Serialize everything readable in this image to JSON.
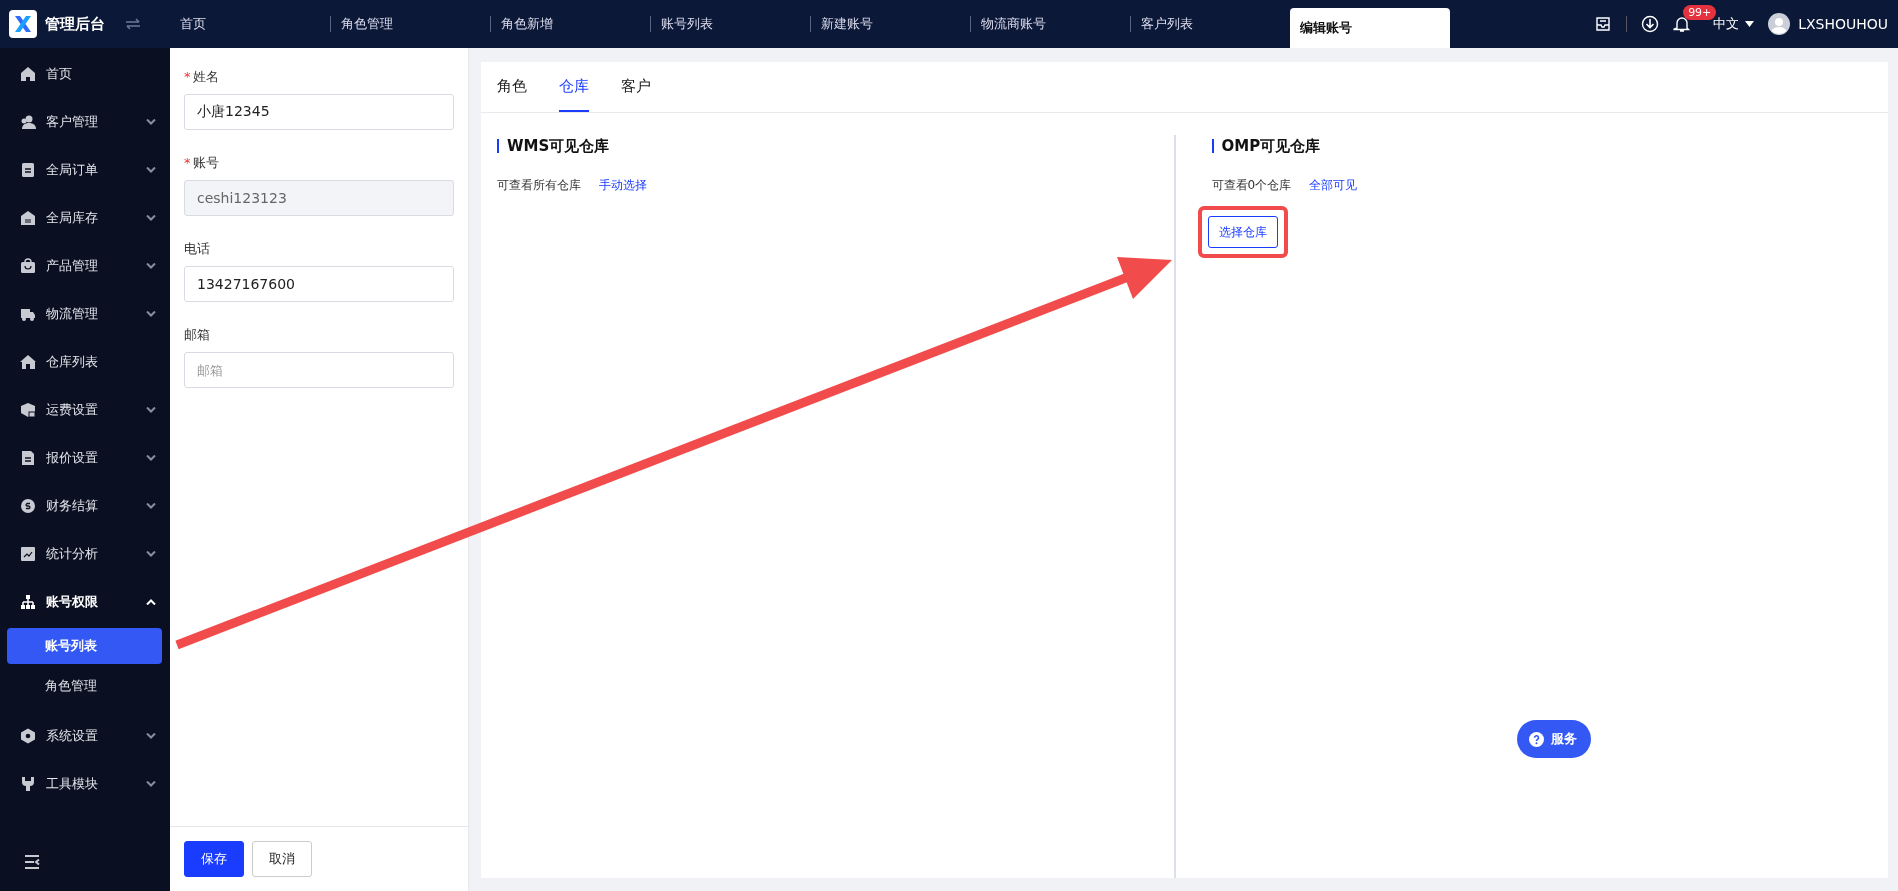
{
  "app": {
    "title": "管理后台"
  },
  "tabs": [
    {
      "label": "首页",
      "selected": false
    },
    {
      "label": "角色管理",
      "selected": false
    },
    {
      "label": "角色新增",
      "selected": false
    },
    {
      "label": "账号列表",
      "selected": false
    },
    {
      "label": "新建账号",
      "selected": false
    },
    {
      "label": "物流商账号",
      "selected": false
    },
    {
      "label": "客户列表",
      "selected": false
    },
    {
      "label": "编辑账号",
      "selected": true
    }
  ],
  "header": {
    "notification_badge": "99+",
    "language": "中文",
    "username": "LXSHOUHOU"
  },
  "sidebar": {
    "items": [
      {
        "label": "首页",
        "kind": "link"
      },
      {
        "label": "客户管理",
        "kind": "group",
        "expanded": false
      },
      {
        "label": "全局订单",
        "kind": "group",
        "expanded": false
      },
      {
        "label": "全局库存",
        "kind": "group",
        "expanded": false
      },
      {
        "label": "产品管理",
        "kind": "group",
        "expanded": false
      },
      {
        "label": "物流管理",
        "kind": "group",
        "expanded": false
      },
      {
        "label": "仓库列表",
        "kind": "link"
      },
      {
        "label": "运费设置",
        "kind": "group",
        "expanded": false
      },
      {
        "label": "报价设置",
        "kind": "group",
        "expanded": false
      },
      {
        "label": "财务结算",
        "kind": "group",
        "expanded": false
      },
      {
        "label": "统计分析",
        "kind": "group",
        "expanded": false
      },
      {
        "label": "账号权限",
        "kind": "group",
        "expanded": true,
        "children": [
          {
            "label": "账号列表",
            "selected": true
          },
          {
            "label": "角色管理",
            "selected": false
          }
        ]
      },
      {
        "label": "系统设置",
        "kind": "group",
        "expanded": false
      },
      {
        "label": "工具模块",
        "kind": "group",
        "expanded": false
      }
    ]
  },
  "form": {
    "fields": [
      {
        "required_mark": "*",
        "label": "姓名",
        "value": "小唐12345",
        "disabled": false
      },
      {
        "required_mark": "*",
        "label": "账号",
        "value": "ceshi123123",
        "disabled": true
      },
      {
        "label": "电话",
        "value": "13427167600",
        "disabled": false
      },
      {
        "label": "邮箱",
        "placeholder": "邮箱",
        "disabled": false
      }
    ],
    "buttons": [
      {
        "label": "保存",
        "kind": "primary"
      },
      {
        "label": "取消",
        "kind": "default"
      }
    ]
  },
  "panel": {
    "tabs": [
      {
        "label": "角色",
        "selected": false
      },
      {
        "label": "仓库",
        "selected": true
      },
      {
        "label": "客户",
        "selected": false
      }
    ],
    "sections": [
      {
        "title": "WMS可见仓库",
        "summary": "可查看所有仓库",
        "link": "手动选择"
      },
      {
        "title": "OMP可见仓库",
        "summary": "可查看0个仓库",
        "link": "全部可见",
        "button": "选择仓库"
      }
    ]
  },
  "service_button": {
    "label": "服务"
  }
}
